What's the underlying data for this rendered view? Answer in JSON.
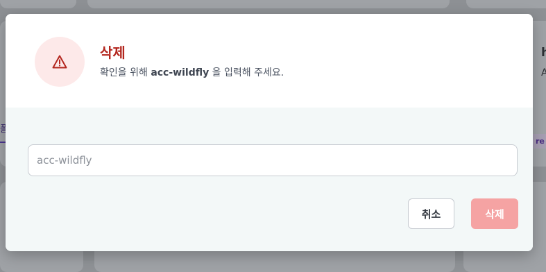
{
  "background": {
    "edge_texts": [
      "h",
      "A"
    ],
    "left_link": "폴",
    "right_badge": "re"
  },
  "modal": {
    "title": "삭제",
    "description_prefix": "확인을 위해 ",
    "description_target": "acc-wildfly",
    "description_suffix": " 을 입력해 주세요.",
    "input": {
      "value": "",
      "placeholder": "acc-wildfly"
    },
    "cancel_label": "취소",
    "delete_label": "삭제",
    "colors": {
      "danger": "#b3261e",
      "danger_soft": "#fde9e9",
      "delete_disabled": "#f5a3a3"
    },
    "icon": "warning-triangle-icon"
  }
}
